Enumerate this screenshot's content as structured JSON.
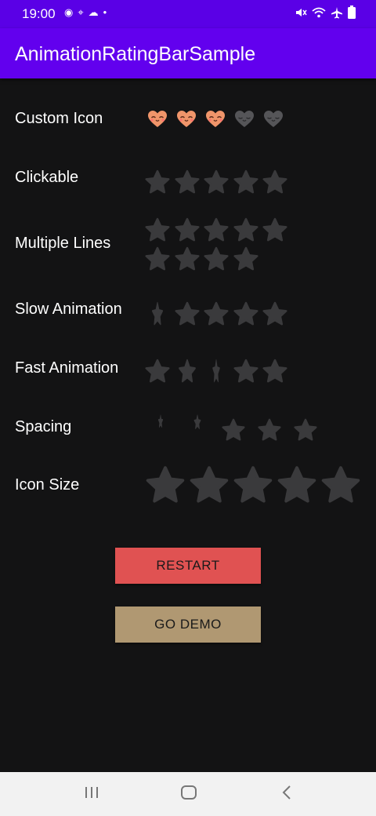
{
  "status_bar": {
    "time": "19:00",
    "left_icons": [
      "at-icon",
      "location-icon",
      "cloud-icon",
      "dot-icon"
    ],
    "right_icons": [
      "mute-icon",
      "wifi-icon",
      "airplane-icon",
      "battery-icon"
    ]
  },
  "app_bar": {
    "title": "AnimationRatingBarSample"
  },
  "colors": {
    "status_bar": "#5a00e6",
    "app_bar": "#6200ee",
    "background": "#131314",
    "star_empty": "#3a3a3c",
    "heart_filled": "#f0956a",
    "heart_empty": "#555558",
    "restart_button": "#e05252",
    "demo_button": "#b09872",
    "nav_bar": "#f2f2f2"
  },
  "rows": [
    {
      "label": "Custom Icon",
      "icon": "heart-face-icon",
      "rating": 3,
      "total": 5
    },
    {
      "label": "Clickable",
      "icon": "star-icon",
      "rating": 0,
      "total": 5
    },
    {
      "label": "Multiple Lines",
      "icon": "star-icon",
      "rating": 0,
      "total": 9
    },
    {
      "label": "Slow Animation",
      "icon": "star-icon",
      "rating": 0,
      "total": 5
    },
    {
      "label": "Fast Animation",
      "icon": "star-icon",
      "rating": 0,
      "total": 5
    },
    {
      "label": "Spacing",
      "icon": "star-icon",
      "rating": 0,
      "total": 5
    },
    {
      "label": "Icon Size",
      "icon": "star-icon",
      "rating": 0,
      "total": 5
    }
  ],
  "buttons": {
    "restart": "RESTART",
    "demo": "GO DEMO"
  },
  "nav_bar": {
    "icons": [
      "recent-apps-icon",
      "home-icon",
      "back-icon"
    ]
  }
}
